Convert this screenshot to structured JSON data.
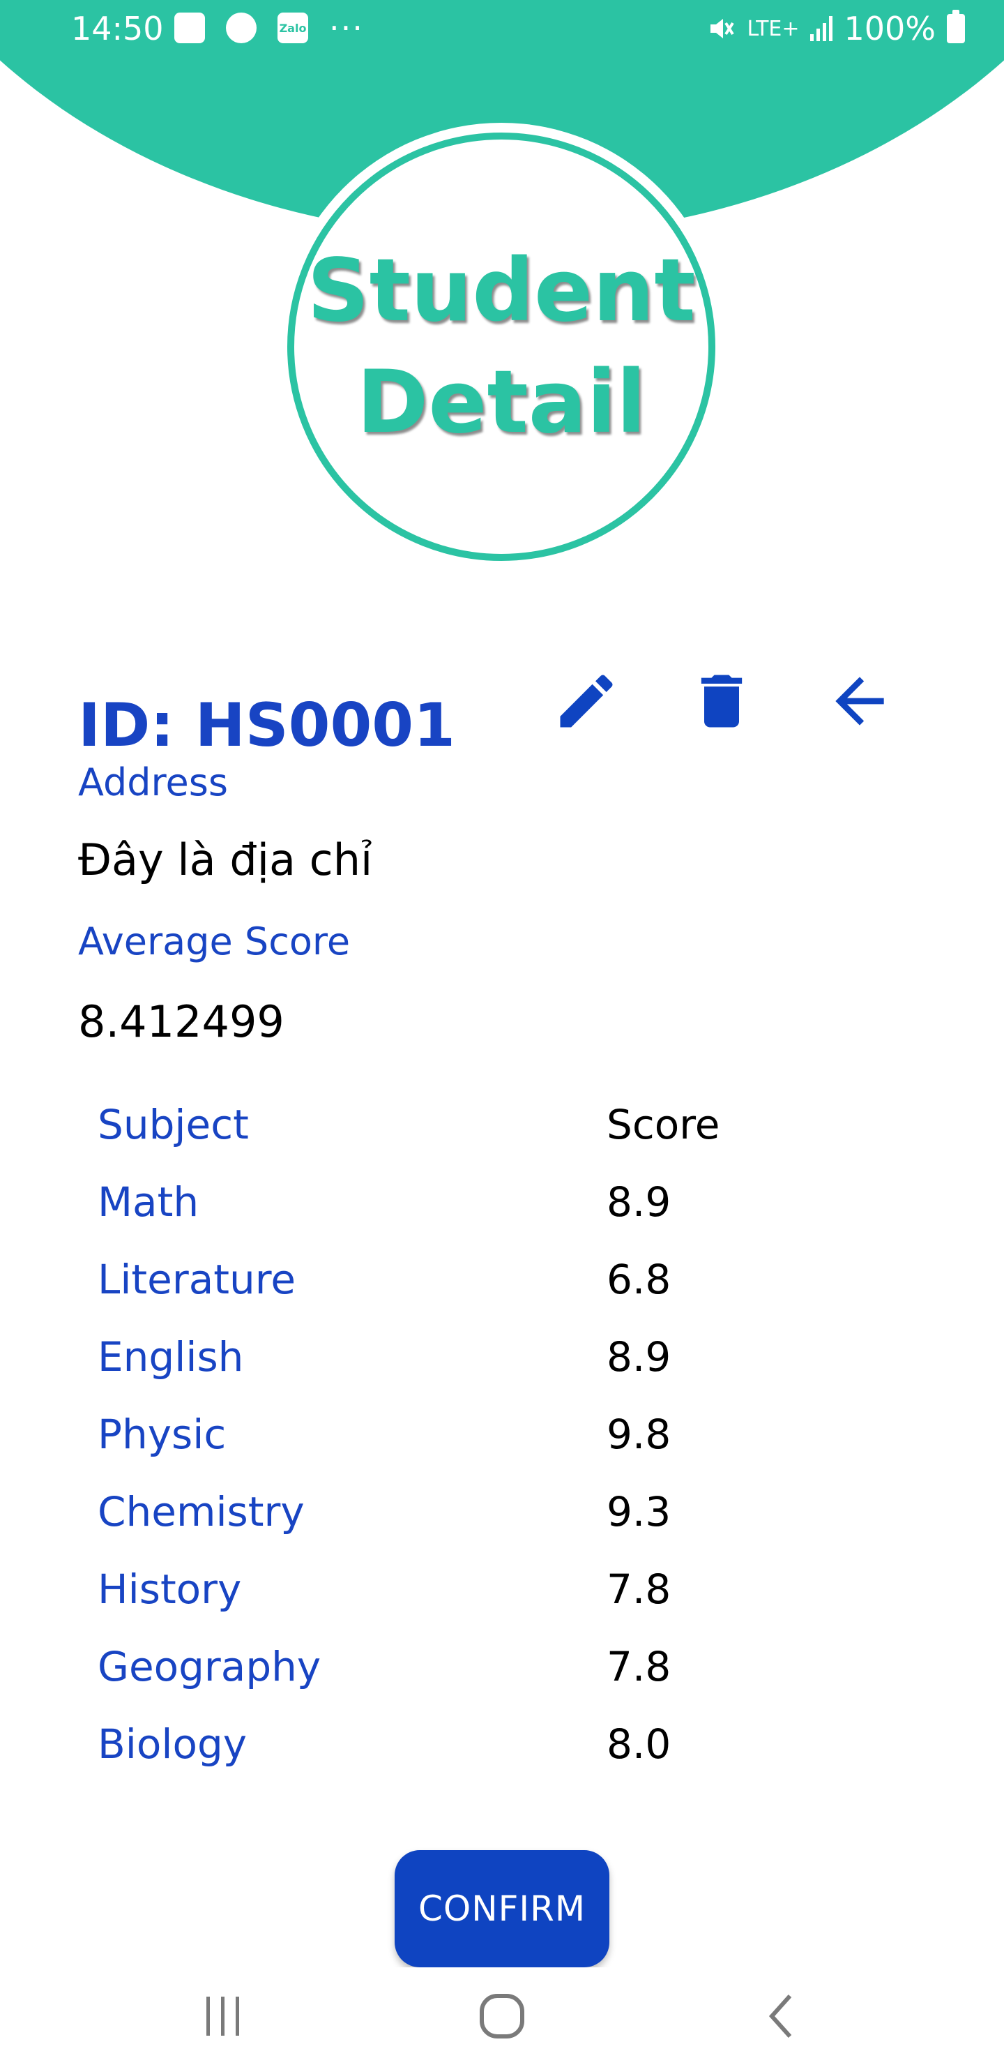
{
  "status_bar": {
    "time": "14:50",
    "network": "LTE+",
    "battery": "100%",
    "notif_app_label": "Zalo",
    "more": "···"
  },
  "header": {
    "title_line1": "Student",
    "title_line2": "Detail"
  },
  "student": {
    "id_text": "ID: HS0001",
    "address_label": "Address",
    "address_value": "Đây là địa chỉ",
    "average_label": "Average Score",
    "average_value": "8.412499"
  },
  "toolbar": {
    "edit_icon": "pencil-icon",
    "delete_icon": "trash-icon",
    "back_icon": "arrow-left-icon"
  },
  "scores": {
    "header": {
      "subject": "Subject",
      "score": "Score"
    },
    "rows": [
      {
        "subject": "Math",
        "score": "8.9"
      },
      {
        "subject": "Literature",
        "score": "6.8"
      },
      {
        "subject": "English",
        "score": "8.9"
      },
      {
        "subject": "Physic",
        "score": "9.8"
      },
      {
        "subject": "Chemistry",
        "score": "9.3"
      },
      {
        "subject": "History",
        "score": "7.8"
      },
      {
        "subject": "Geography",
        "score": "7.8"
      },
      {
        "subject": "Biology",
        "score": "8.0"
      }
    ]
  },
  "actions": {
    "confirm_label": "CONFIRM"
  },
  "colors": {
    "accent": "#2bc3a3",
    "primary": "#1844c3",
    "button": "#0f44c1"
  }
}
